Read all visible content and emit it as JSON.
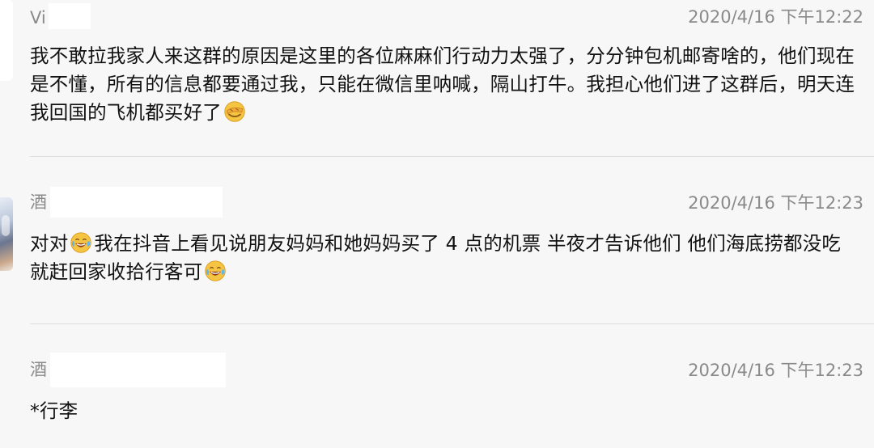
{
  "messages": [
    {
      "sender": "Vi",
      "timestamp": "2020/4/16 下午12:22",
      "text_before_emoji": "我不敢拉我家人来这群的原因是这里的各位麻麻们行动力太强了，分分钟包机邮寄啥的，他们现在是不懂，所有的信息都要通过我，只能在微信里呐喊，隔山打牛。我担心他们进了这群后，明天连我回国的飞机都买好了",
      "emoji": "facepalm-emoji"
    },
    {
      "sender": "酒",
      "timestamp": "2020/4/16 下午12:23",
      "text_part_1": "对对",
      "text_part_2": "我在抖音上看见说朋友妈妈和她妈妈买了 4 点的机票 半夜才告诉他们 他们海底捞都没吃就赶回家收拾行客可",
      "emoji": "tears-of-joy-emoji"
    },
    {
      "sender": "酒",
      "timestamp": "2020/4/16 下午12:23",
      "text": "*行李"
    }
  ],
  "colors": {
    "background": "#f7f7f7",
    "meta_text": "#8a8a8a",
    "body_text": "#111111",
    "divider": "#dedede",
    "emoji_face": "#f6c443"
  }
}
